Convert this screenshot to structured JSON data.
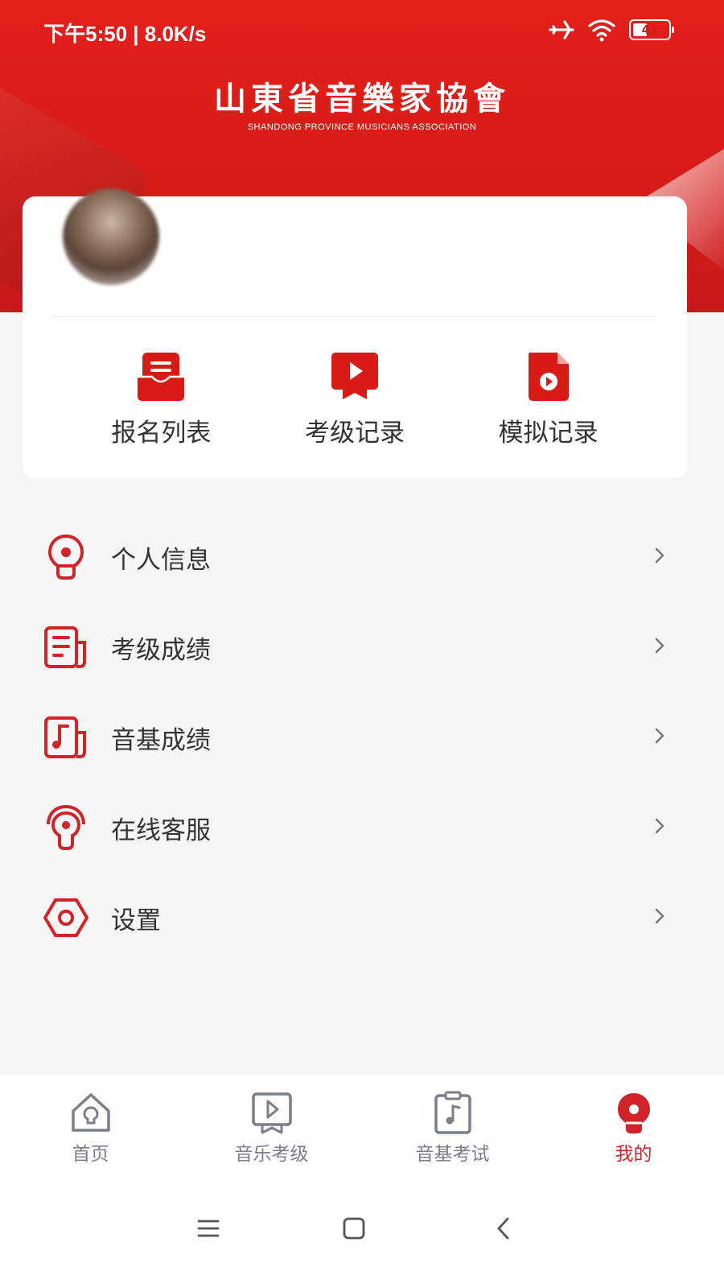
{
  "status_bar": {
    "time_text": "下午5:50 | 8.0K/s",
    "battery_level": "41",
    "battery_fraction": 0.41,
    "icons": [
      "airplane-icon",
      "wifi-icon",
      "battery-icon"
    ]
  },
  "header": {
    "logo_cn": "山東省音樂家協會",
    "logo_en": "SHANDONG PROVINCE MUSICIANS ASSOCIATION"
  },
  "quick_actions": [
    {
      "label": "报名列表",
      "icon": "inbox-list-icon"
    },
    {
      "label": "考级记录",
      "icon": "video-play-icon"
    },
    {
      "label": "模拟记录",
      "icon": "file-play-icon"
    }
  ],
  "menu": [
    {
      "label": "个人信息",
      "icon": "user-info-icon"
    },
    {
      "label": "考级成绩",
      "icon": "document-icon"
    },
    {
      "label": "音基成绩",
      "icon": "music-sheet-icon"
    },
    {
      "label": "在线客服",
      "icon": "headset-icon"
    },
    {
      "label": "设置",
      "icon": "settings-icon"
    }
  ],
  "tabs": [
    {
      "label": "首页",
      "icon": "home-icon",
      "active": false
    },
    {
      "label": "音乐考级",
      "icon": "play-board-icon",
      "active": false
    },
    {
      "label": "音基考试",
      "icon": "clipboard-music-icon",
      "active": false
    },
    {
      "label": "我的",
      "icon": "profile-icon",
      "active": true
    }
  ],
  "colors": {
    "brand_red": "#d71c18",
    "accent_red": "#d0242a",
    "text_primary": "#333333",
    "tab_inactive": "#7a7f89",
    "background": "#f6f6f6"
  }
}
